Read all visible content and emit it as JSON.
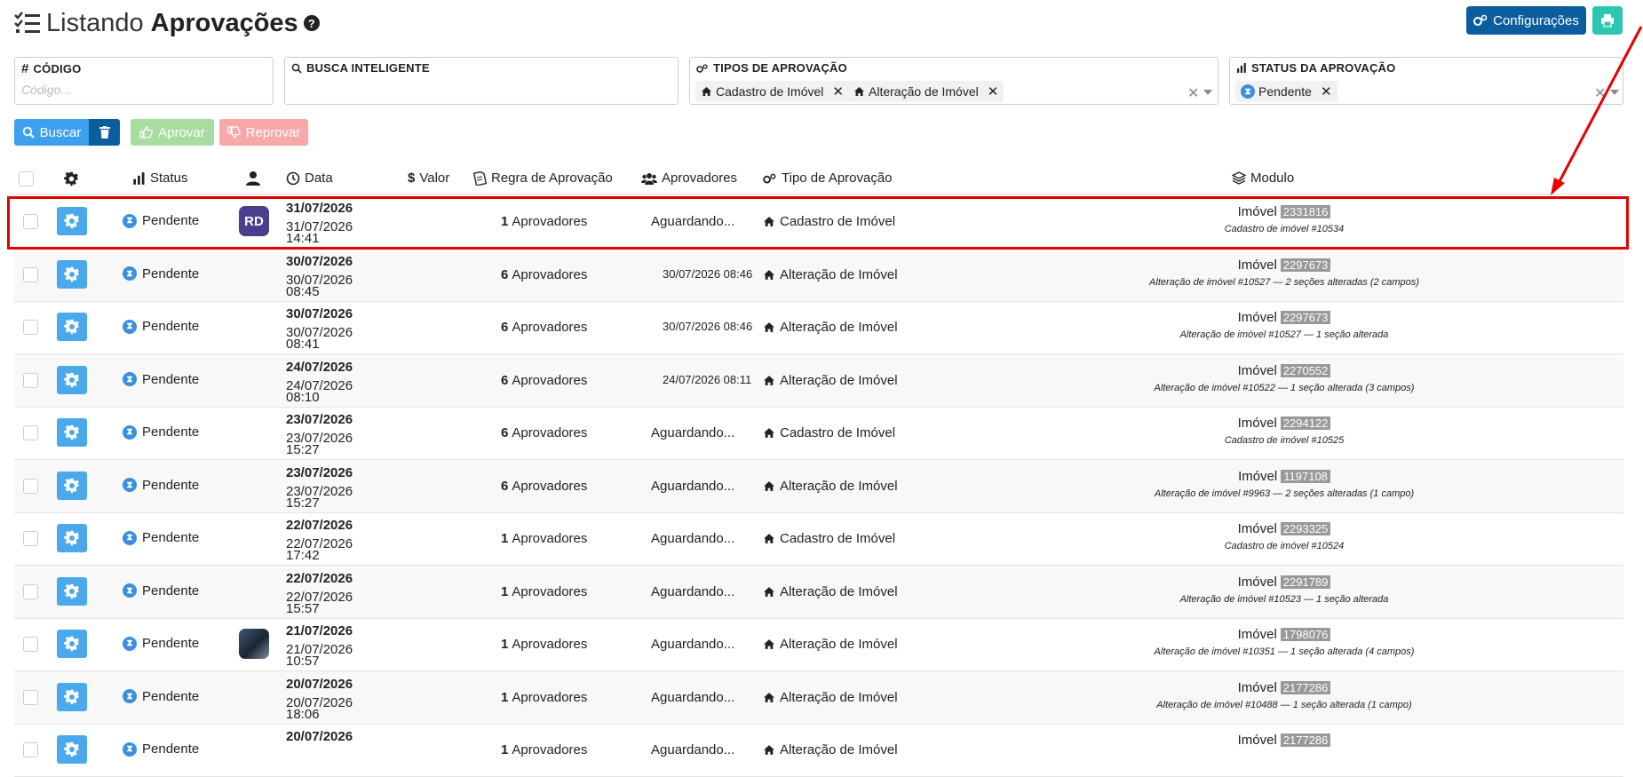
{
  "header": {
    "title_light": "Listando",
    "title_bold": "Aprovações",
    "config_label": "Configurações"
  },
  "filters": {
    "codigo_label": "CÓDIGO",
    "codigo_placeholder": "Código...",
    "busca_label": "BUSCA INTELIGENTE",
    "tipos_label": "TIPOS DE APROVAÇÃO",
    "tipos_chips": [
      "Cadastro de Imóvel",
      "Alteração de Imóvel"
    ],
    "status_label": "STATUS DA APROVAÇÃO",
    "status_chips": [
      "Pendente"
    ]
  },
  "actions": {
    "buscar": "Buscar",
    "aprovar": "Aprovar",
    "reprovar": "Reprovar"
  },
  "columns": {
    "status": "Status",
    "data": "Data",
    "valor": "Valor",
    "regra": "Regra de Aprovação",
    "aprovadores": "Aprovadores",
    "tipo": "Tipo de Aprovação",
    "modulo": "Modulo"
  },
  "rows": [
    {
      "status": "Pendente",
      "avatar": "RD",
      "date": "31/07/2026",
      "date_sub": "31/07/2026",
      "time": "14:41",
      "count": "1",
      "count_label": "Aprovadores",
      "aprov": "Aguardando...",
      "tipo": "Cadastro de Imóvel",
      "mod": "Imóvel",
      "mod_id": "2331816",
      "mod_desc": "Cadastro de imóvel #10534"
    },
    {
      "status": "Pendente",
      "avatar": "",
      "date": "30/07/2026",
      "date_sub": "30/07/2026",
      "time": "08:45",
      "count": "6",
      "count_label": "Aprovadores",
      "aprov": "30/07/2026 08:46",
      "tipo": "Alteração de Imóvel",
      "mod": "Imóvel",
      "mod_id": "2297673",
      "mod_desc": "Alteração de imóvel #10527 — 2 seções alteradas (2 campos)"
    },
    {
      "status": "Pendente",
      "avatar": "",
      "date": "30/07/2026",
      "date_sub": "30/07/2026",
      "time": "08:41",
      "count": "6",
      "count_label": "Aprovadores",
      "aprov": "30/07/2026 08:46",
      "tipo": "Alteração de Imóvel",
      "mod": "Imóvel",
      "mod_id": "2297673",
      "mod_desc": "Alteração de imóvel #10527 — 1 seção alterada"
    },
    {
      "status": "Pendente",
      "avatar": "",
      "date": "24/07/2026",
      "date_sub": "24/07/2026",
      "time": "08:10",
      "count": "6",
      "count_label": "Aprovadores",
      "aprov": "24/07/2026 08:11",
      "tipo": "Alteração de Imóvel",
      "mod": "Imóvel",
      "mod_id": "2270552",
      "mod_desc": "Alteração de imóvel #10522 — 1 seção alterada (3 campos)"
    },
    {
      "status": "Pendente",
      "avatar": "",
      "date": "23/07/2026",
      "date_sub": "23/07/2026",
      "time": "15:27",
      "count": "6",
      "count_label": "Aprovadores",
      "aprov": "Aguardando...",
      "tipo": "Cadastro de Imóvel",
      "mod": "Imóvel",
      "mod_id": "2294122",
      "mod_desc": "Cadastro de imóvel #10525"
    },
    {
      "status": "Pendente",
      "avatar": "",
      "date": "23/07/2026",
      "date_sub": "23/07/2026",
      "time": "15:27",
      "count": "6",
      "count_label": "Aprovadores",
      "aprov": "Aguardando...",
      "tipo": "Alteração de Imóvel",
      "mod": "Imóvel",
      "mod_id": "1197108",
      "mod_desc": "Alteração de imóvel #9963 — 2 seções alteradas (1 campo)"
    },
    {
      "status": "Pendente",
      "avatar": "",
      "date": "22/07/2026",
      "date_sub": "22/07/2026",
      "time": "17:42",
      "count": "1",
      "count_label": "Aprovadores",
      "aprov": "Aguardando...",
      "tipo": "Cadastro de Imóvel",
      "mod": "Imóvel",
      "mod_id": "2293325",
      "mod_desc": "Cadastro de imóvel #10524"
    },
    {
      "status": "Pendente",
      "avatar": "",
      "date": "22/07/2026",
      "date_sub": "22/07/2026",
      "time": "15:57",
      "count": "1",
      "count_label": "Aprovadores",
      "aprov": "Aguardando...",
      "tipo": "Alteração de Imóvel",
      "mod": "Imóvel",
      "mod_id": "2291789",
      "mod_desc": "Alteração de imóvel #10523 — 1 seção alterada"
    },
    {
      "status": "Pendente",
      "avatar": "photo",
      "date": "21/07/2026",
      "date_sub": "21/07/2026",
      "time": "10:57",
      "count": "1",
      "count_label": "Aprovadores",
      "aprov": "Aguardando...",
      "tipo": "Alteração de Imóvel",
      "mod": "Imóvel",
      "mod_id": "1798076",
      "mod_desc": "Alteração de imóvel #10351 — 1 seção alterada (4 campos)"
    },
    {
      "status": "Pendente",
      "avatar": "",
      "date": "20/07/2026",
      "date_sub": "20/07/2026",
      "time": "18:06",
      "count": "1",
      "count_label": "Aprovadores",
      "aprov": "Aguardando...",
      "tipo": "Alteração de Imóvel",
      "mod": "Imóvel",
      "mod_id": "2177286",
      "mod_desc": "Alteração de imóvel #10488 — 1 seção alterada (1 campo)"
    },
    {
      "status": "Pendente",
      "avatar": "",
      "date": "20/07/2026",
      "date_sub": "",
      "time": "",
      "count": "1",
      "count_label": "Aprovadores",
      "aprov": "Aguardando...",
      "tipo": "Alteração de Imóvel",
      "mod": "Imóvel",
      "mod_id": "2177286",
      "mod_desc": ""
    }
  ]
}
